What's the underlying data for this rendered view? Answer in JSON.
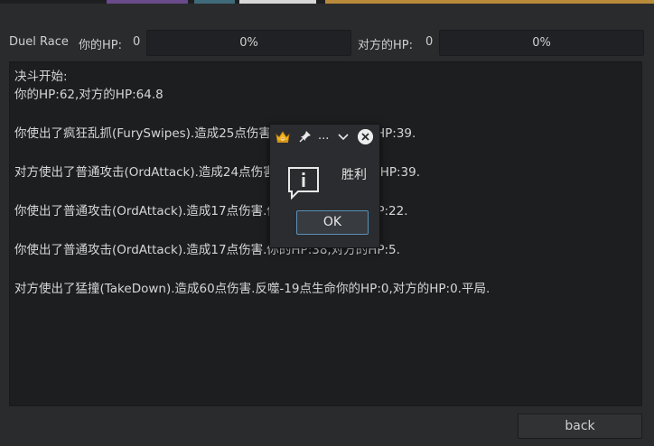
{
  "header": {
    "title": "Duel Race",
    "my_hp_label": "你的HP:",
    "my_hp_value": "0",
    "my_hp_bar_text": "0%",
    "my_hp_fraction": 0,
    "enemy_hp_label": "对方的HP:",
    "enemy_hp_value": "0",
    "enemy_hp_bar_text": "0%",
    "enemy_hp_fraction": 0
  },
  "log": {
    "lines": [
      "决斗开始:",
      "你的HP:62,对方的HP:64.8",
      "你使出了疯狂乱抓(FurySwipes).造成25点伤害.你的HP:62,对方的HP:39.",
      "对方使出了普通攻击(OrdAttack).造成24点伤害.你的HP:38,对方的HP:39.",
      "你使出了普通攻击(OrdAttack).造成17点伤害.你的HP:38,对方的HP:22.",
      "你使出了普通攻击(OrdAttack).造成17点伤害.你的HP:38,对方的HP:5.",
      "对方使出了猛撞(TakeDown).造成60点伤害.反噬-19点生命你的HP:0,对方的HP:0.平局."
    ]
  },
  "footer": {
    "back_label": "back"
  },
  "dialog": {
    "title": "...",
    "message": "胜利",
    "ok_label": "OK",
    "app_icon": "crown-icon",
    "pin_icon": "pin-icon",
    "menu_icon": "chevron-down-icon",
    "close_icon": "close-icon",
    "info_icon": "info-icon"
  },
  "colors": {
    "background": "#2a2b2d",
    "panel": "#1d1e20",
    "text": "#d6d6d6",
    "accent_border": "#5a90b8"
  }
}
